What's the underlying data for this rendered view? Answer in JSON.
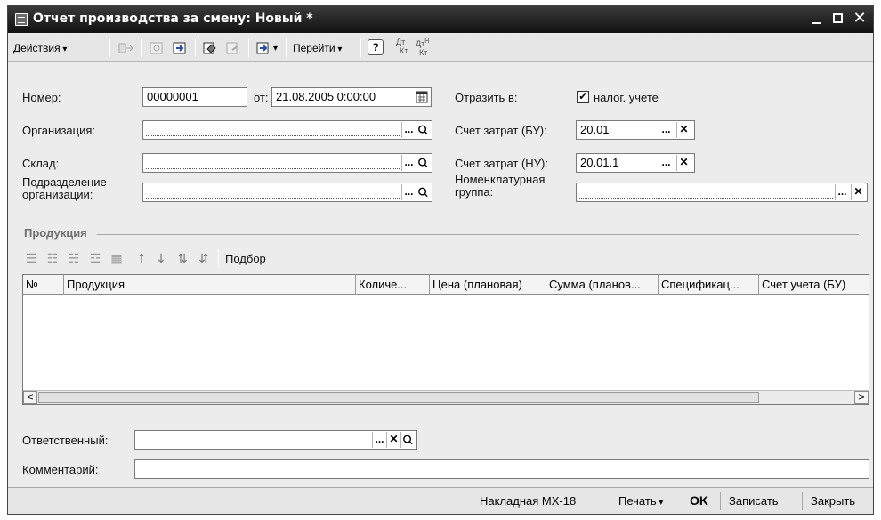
{
  "window": {
    "title": "Отчет производства за смену: Новый *",
    "icon": "document-form-icon",
    "controls": [
      "minimize-icon",
      "maximize-icon",
      "close-icon"
    ],
    "close_glyph": "✕"
  },
  "toolbar": {
    "actions_label": "Действия",
    "goto_label": "Перейти",
    "help_label": "?",
    "dt_label": "Дт",
    "kt_label": "Кт",
    "dtn_label": "Дт",
    "dtn_sup": "Н",
    "ktn_label": "Кт"
  },
  "form": {
    "number_label": "Номер:",
    "number_value": "00000001",
    "from_label": "от:",
    "date_value": "21.08.2005  0:00:00",
    "reflect_label": "Отразить в:",
    "tax_checkbox_label": "налог. учете",
    "tax_checked": true,
    "check_glyph": "✔",
    "org_label": "Организация:",
    "org_value": "",
    "cost_bu_label": "Счет затрат (БУ):",
    "cost_bu_value": "20.01",
    "warehouse_label": "Склад:",
    "warehouse_value": "",
    "cost_nu_label": "Счет затрат (НУ):",
    "cost_nu_value": "20.01.1",
    "division_label_1": "Подразделение",
    "division_label_2": "организации:",
    "division_value": "",
    "nomgroup_label_1": "Номенклатурная",
    "nomgroup_label_2": "группа:",
    "nomgroup_value": "",
    "select_btn": "...",
    "clear_btn": "✕",
    "search_btn": "🔍"
  },
  "products": {
    "section_title": "Продукция",
    "selection_label": "Подбор",
    "columns": [
      "№",
      "Продукция",
      "Количе...",
      "Цена (плановая)",
      "Сумма (планов...",
      "Спецификац...",
      "Счет учета (БУ)"
    ],
    "rows": [],
    "scroll_left": "<",
    "scroll_right": ">"
  },
  "footer_fields": {
    "responsible_label": "Ответственный:",
    "responsible_value": "",
    "comment_label": "Комментарий:",
    "comment_value": ""
  },
  "statusbar": {
    "invoice_label": "Накладная МХ-18",
    "print_label": "Печать",
    "ok_label": "OK",
    "save_label": "Записать",
    "close_label": "Закрыть"
  }
}
